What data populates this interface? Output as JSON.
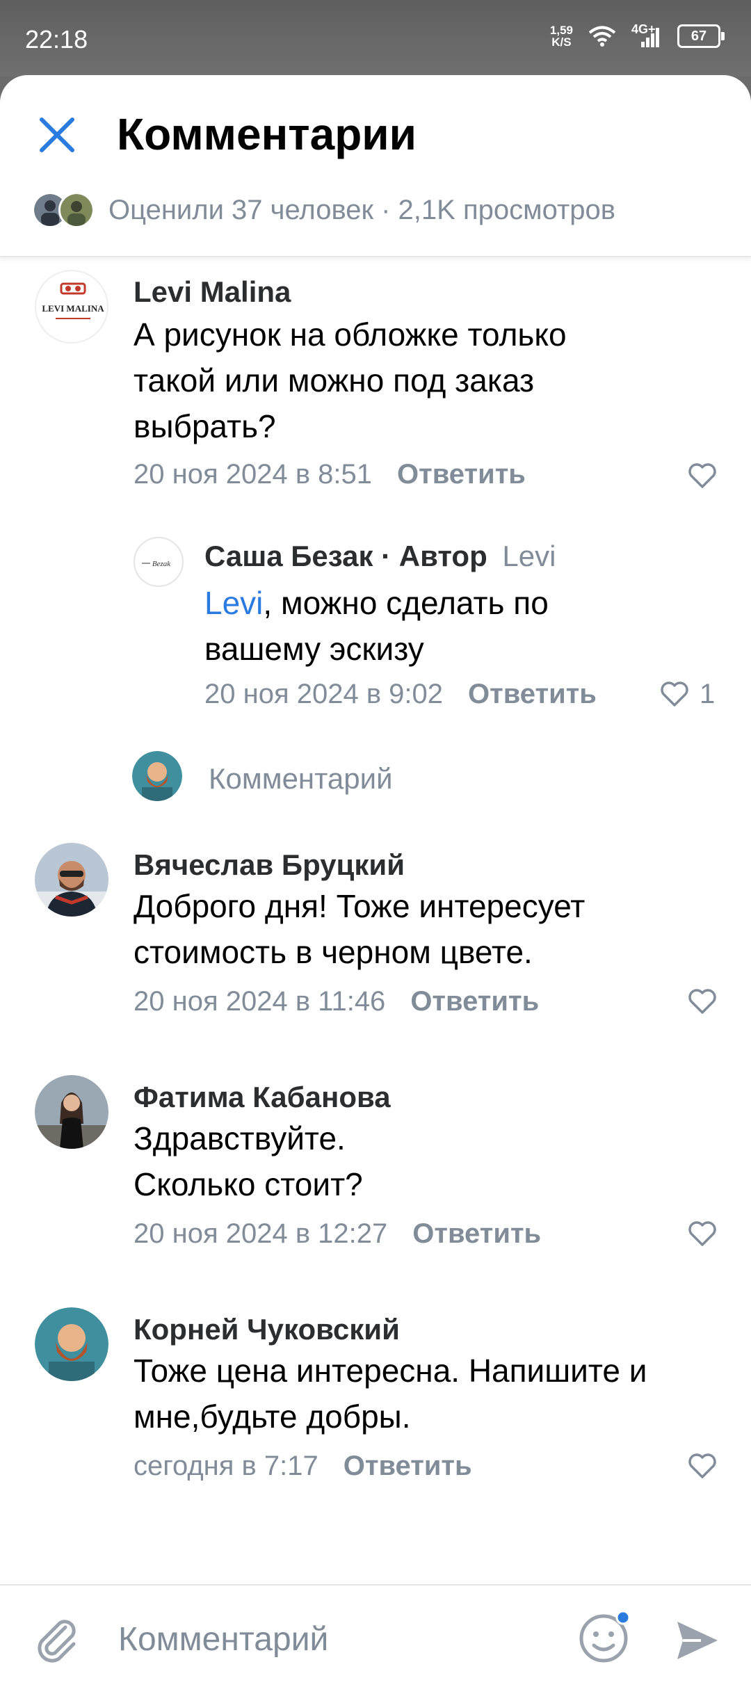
{
  "status": {
    "time": "22:18",
    "speed_value": "1,59",
    "speed_unit": "K/S",
    "network": "4G+",
    "battery": "67"
  },
  "header": {
    "title": "Комментарии",
    "stats": "Оценили 37 человек · 2,1K просмотров",
    "close_icon": "close-icon"
  },
  "comments": [
    {
      "name": "Levi Malina",
      "avatar_text": "LEVI MALINA",
      "text_line1": "А рисунок на обложке только",
      "text_line2": "такой или можно под заказ",
      "text_line3": "выбрать?",
      "date": "20 ноя 2024 в 8:51",
      "reply_label": "Ответить"
    },
    {
      "name": "Саша Безак · Автор",
      "reply_to": "Levi",
      "avatar_text": "Bezak",
      "mention": "Levi",
      "text_after_mention": ", можно сделать по",
      "text_line2": "вашему эскизу",
      "date": "20 ноя 2024 в 9:02",
      "reply_label": "Ответить",
      "likes": "1"
    },
    {
      "name": "Вячеслав Бруцкий",
      "text_line1": "Доброго дня! Тоже интересует",
      "text_line2": "стоимость в черном цвете.",
      "date": "20 ноя 2024 в 11:46",
      "reply_label": "Ответить"
    },
    {
      "name": "Фатима Кабанова",
      "text_line1": "Здравствуйте.",
      "text_line2": "Сколько стоит?",
      "date": "20 ноя 2024 в 12:27",
      "reply_label": "Ответить"
    },
    {
      "name": "Корней Чуковский",
      "text_line1": "Тоже цена интересна. Напишите и",
      "text_line2": "мне,будьте добры.",
      "date": "сегодня в 7:17",
      "reply_label": "Ответить"
    }
  ],
  "thread_reply": {
    "placeholder": "Комментарий"
  },
  "composer": {
    "placeholder": "Комментарий"
  },
  "colors": {
    "accent": "#2a7be0",
    "secondary_text": "#818c99"
  }
}
